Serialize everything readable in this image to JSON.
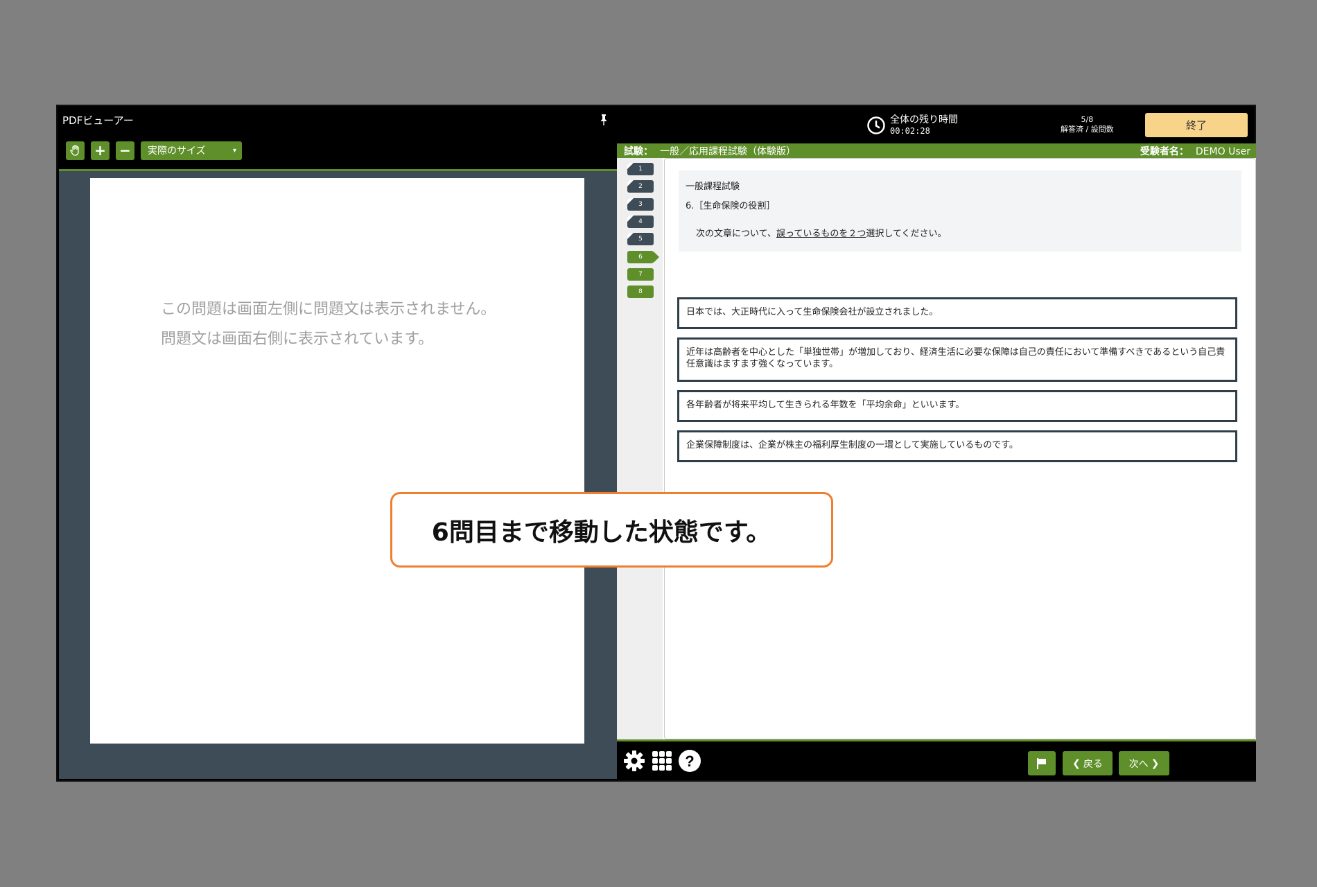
{
  "pdf_viewer": {
    "title": "PDFビューアー",
    "zoom_select": "実際のサイズ",
    "message_line1": "この問題は画面左側に問題文は表示されません。",
    "message_line2": "問題文は画面右側に表示されています。"
  },
  "header": {
    "timer_label": "全体の残り時間",
    "timer_value": "00:02:28",
    "progress_count": "5/8",
    "progress_label": "解答済 / 設問数",
    "end_button": "終了"
  },
  "exam_bar": {
    "exam_label": "試験：",
    "exam_name": "一般／応用課程試験（体験版）",
    "user_label": "受験者名：",
    "user_name": "DEMO User"
  },
  "question_nav": [
    {
      "num": "1",
      "state": "answered"
    },
    {
      "num": "2",
      "state": "answered"
    },
    {
      "num": "3",
      "state": "answered"
    },
    {
      "num": "4",
      "state": "answered"
    },
    {
      "num": "5",
      "state": "answered"
    },
    {
      "num": "6",
      "state": "current"
    },
    {
      "num": "7",
      "state": "unanswered"
    },
    {
      "num": "8",
      "state": "unanswered"
    }
  ],
  "question": {
    "category": "一般課程試験",
    "number_title": "6.［生命保険の役割］",
    "instruction_pre": "次の文章について、",
    "instruction_underlined": "誤っているものを２つ",
    "instruction_post": "選択してください。"
  },
  "choices": [
    "日本では、大正時代に入って生命保険会社が設立されました。",
    "近年は高齢者を中心とした「単独世帯」が増加しており、経済生活に必要な保障は自己の責任において準備すべきであるという自己責任意識はますます強くなっています。",
    "各年齢者が将来平均して生きられる年数を「平均余命」といいます。",
    "企業保障制度は、企業が株主の福利厚生制度の一環として実施しているものです。"
  ],
  "footer": {
    "back_button": "戻る",
    "next_button": "次へ"
  },
  "callout": {
    "text": "6問目まで移動した状態です。"
  },
  "colors": {
    "accent_green": "#5f8f2a",
    "dark_slate": "#3d4c56",
    "end_button": "#f7d48a",
    "callout_border": "#ef7f2e"
  }
}
